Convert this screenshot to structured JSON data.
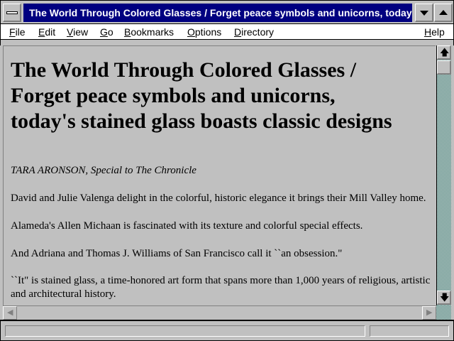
{
  "window": {
    "title": "The World Through Colored Glasses / Forget peace symbols and unicorns, today's"
  },
  "menu": [
    {
      "label": "File",
      "mnemonic": "F",
      "rest": "ile"
    },
    {
      "label": "Edit",
      "mnemonic": "E",
      "rest": "dit"
    },
    {
      "label": "View",
      "mnemonic": "V",
      "rest": "iew"
    },
    {
      "label": "Go",
      "mnemonic": "G",
      "rest": "o"
    },
    {
      "label": "Bookmarks",
      "mnemonic": "B",
      "rest": "ookmarks"
    },
    {
      "label": "Options",
      "mnemonic": "O",
      "rest": "ptions"
    },
    {
      "label": "Directory",
      "mnemonic": "D",
      "rest": "irectory"
    },
    {
      "label": "Help",
      "mnemonic": "H",
      "rest": "elp"
    }
  ],
  "article": {
    "headline_line1": "The World Through Colored Glasses /",
    "headline_line2": "Forget peace symbols and unicorns,",
    "headline_line3": "today's stained glass boasts classic designs",
    "byline": "TARA ARONSON, Special to The Chronicle",
    "paragraphs": [
      "David and Julie Valenga delight in the colorful, historic elegance it brings their Mill Valley home.",
      "Alameda's Allen Michaan is fascinated with its texture and colorful special effects.",
      "And Adriana and Thomas J. Williams of San Francisco call it ``an obsession.\"",
      "``It\" is stained glass, a time-honored art form that spans more than 1,000 years of religious, artistic and architectural history."
    ]
  },
  "status": {
    "text": ""
  },
  "icons": {
    "system_menu": "system-menu-icon",
    "minimize": "chevron-down-icon",
    "maximize": "chevron-up-icon",
    "scroll_up": "arrow-up-icon",
    "scroll_down": "arrow-down-icon",
    "scroll_left": "arrow-left-icon",
    "scroll_right": "arrow-right-icon"
  },
  "colors": {
    "caption": "#000080",
    "chrome": "#c0c0c0",
    "scroll_track": "#5b9b92"
  }
}
